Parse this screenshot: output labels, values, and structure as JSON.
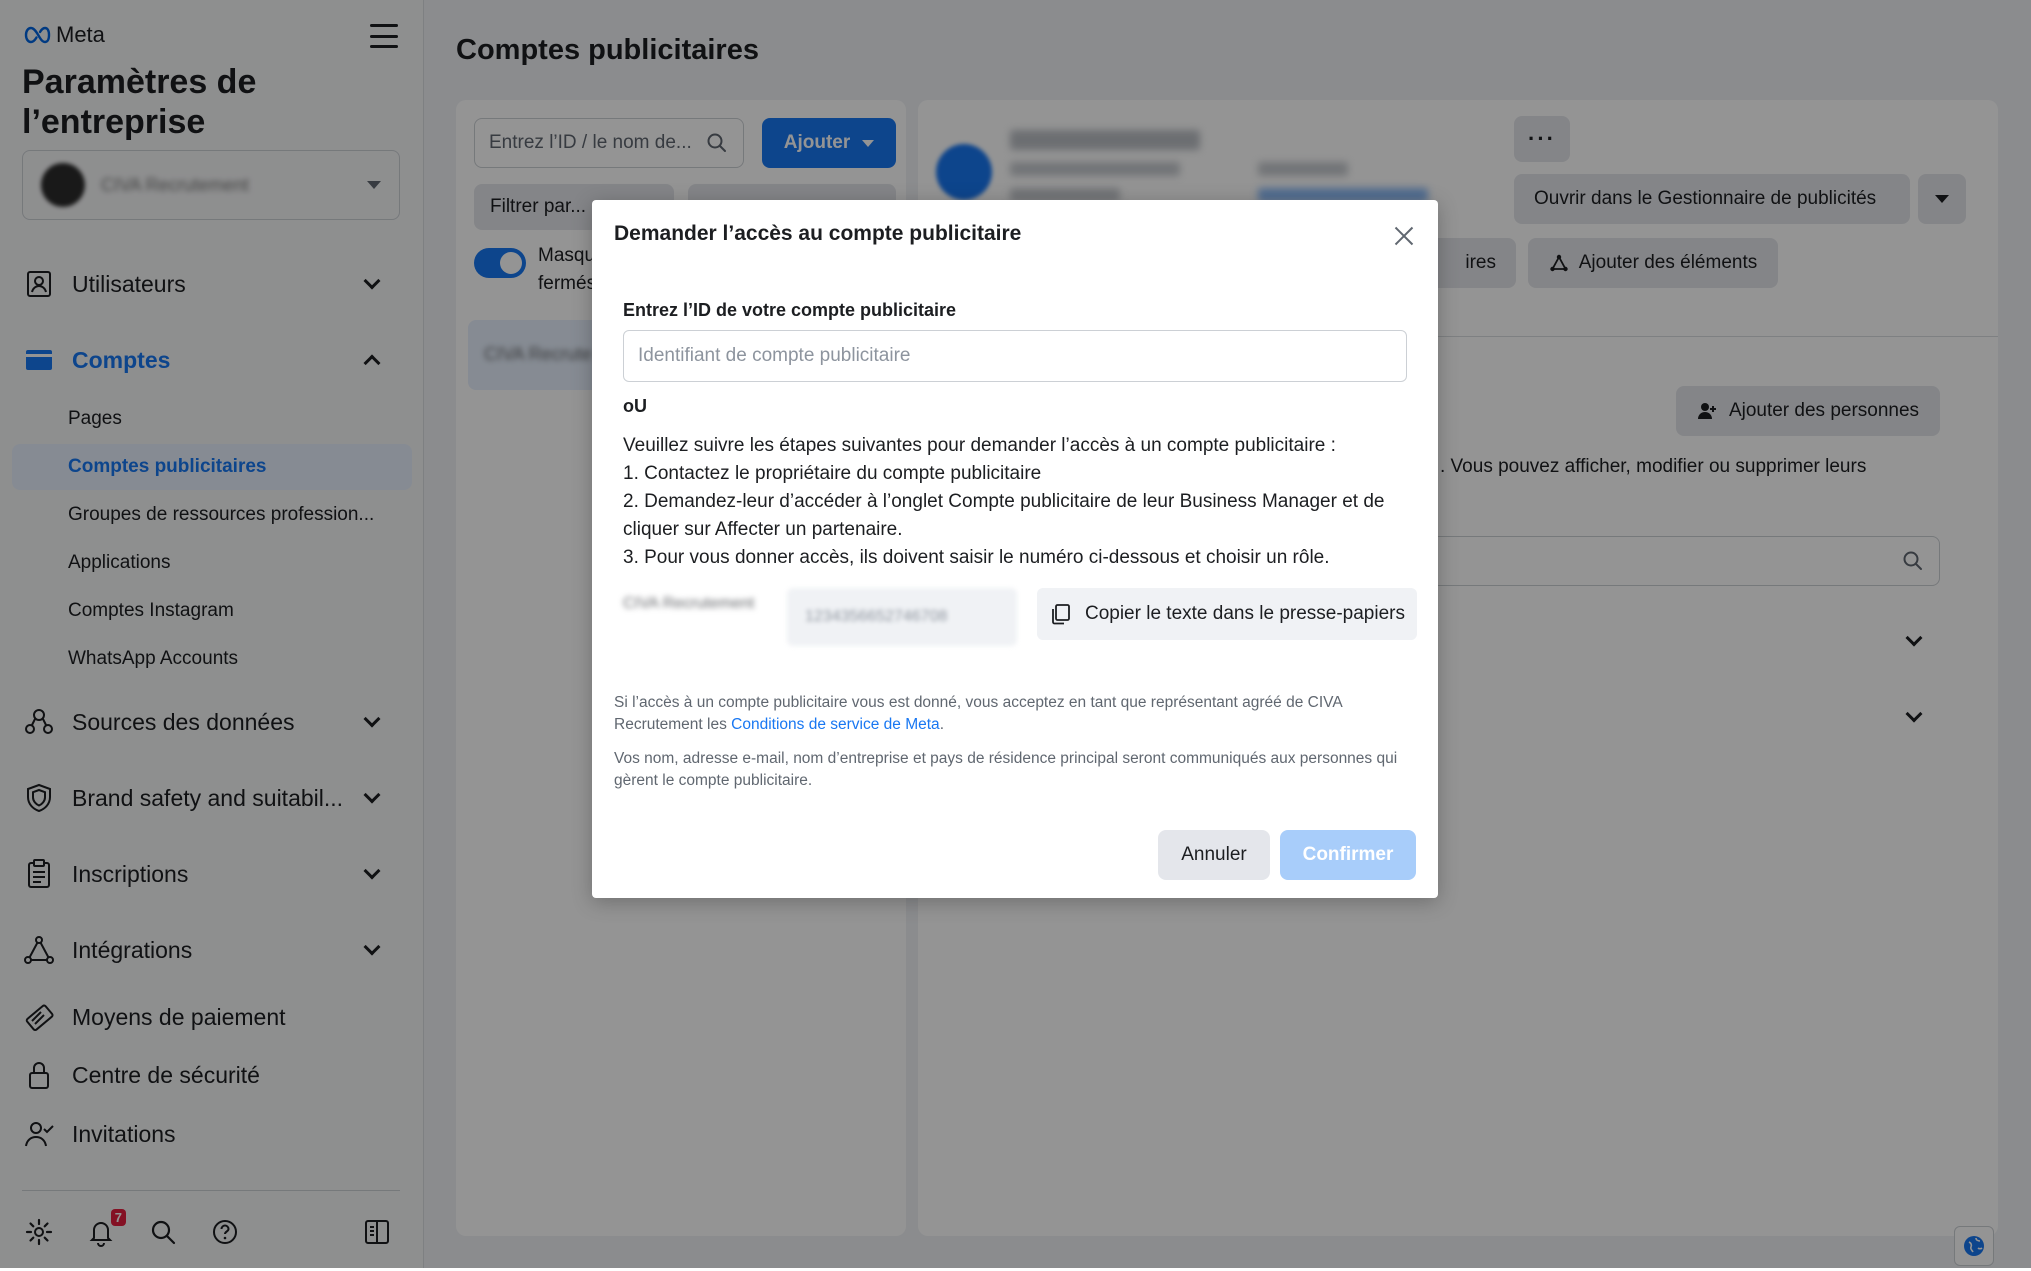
{
  "sidebar": {
    "brand": "Meta",
    "title": "Paramètres de l’entreprise",
    "business_name": "CIVA Recrutement",
    "nav": [
      {
        "label": "Utilisateurs",
        "icon": "users-icon"
      },
      {
        "label": "Comptes",
        "icon": "accounts-icon"
      },
      {
        "label": "Sources des données",
        "icon": "data-sources-icon"
      },
      {
        "label": "Brand safety and suitabil...",
        "icon": "shield-icon"
      },
      {
        "label": "Inscriptions",
        "icon": "clipboard-icon"
      },
      {
        "label": "Intégrations",
        "icon": "integrations-icon"
      },
      {
        "label": "Moyens de paiement",
        "icon": "payment-icon"
      },
      {
        "label": "Centre de sécurité",
        "icon": "lock-icon"
      },
      {
        "label": "Invitations",
        "icon": "invitations-icon"
      }
    ],
    "sub_items": [
      {
        "label": "Pages"
      },
      {
        "label": "Comptes publicitaires"
      },
      {
        "label": "Groupes de ressources profession..."
      },
      {
        "label": "Applications"
      },
      {
        "label": "Comptes Instagram"
      },
      {
        "label": "WhatsApp Accounts"
      }
    ],
    "footer": {
      "notification_count": "7",
      "icons": [
        "settings-icon",
        "bell-icon",
        "search-icon",
        "help-icon",
        "panel-toggle-icon"
      ]
    }
  },
  "main": {
    "page_title": "Comptes publicitaires",
    "search_placeholder": "Entrez l’ID / le nom de...",
    "add_button": "Ajouter",
    "filter_button": "Filtrer par...",
    "toggle_label": "Masqu fermés",
    "list_item": "CIVA Recrute",
    "account_name": "CIVA Recrutement",
    "open_button": "Ouvrir dans le Gestionnaire de publicités",
    "partners_button": "ires",
    "add_assets_button": "Ajouter des éléments",
    "add_people_button": "Ajouter des personnes",
    "people_desc": ". Vous pouvez afficher, modifier ou supprimer leurs"
  },
  "modal": {
    "title": "Demander l’accès au compte publicitaire",
    "id_label": "Entrez l’ID de votre compte publicitaire",
    "id_placeholder": "Identifiant de compte publicitaire",
    "or_text": "oU",
    "steps_intro": "Veuillez suivre les étapes suivantes pour demander l’accès à un compte publicitaire :",
    "step1": "1. Contactez le propriétaire du compte publicitaire",
    "step2": "2. Demandez-leur d’accéder à l’onglet Compte publicitaire de leur Business Manager et de cliquer sur Affecter un partenaire.",
    "step3": "3. Pour vous donner accès, ils doivent saisir le numéro ci-dessous et choisir un rôle.",
    "copy_name": "CIVA Recrutement",
    "copy_id": "1234356652746708",
    "copy_button": "Copier le texte dans le presse-papiers",
    "legal1_text": "Si l’accès à un compte publicitaire vous est donné, vous acceptez en tant que représentant agréé de CIVA Recrutement les ",
    "legal1_link": "Conditions de service de Meta",
    "legal1_end": ".",
    "legal2": "Vos nom, adresse e-mail, nom d’entreprise et pays de résidence principal seront communiqués aux personnes qui gèrent le compte publicitaire.",
    "cancel": "Annuler",
    "confirm": "Confirmer"
  },
  "colors": {
    "accent": "#1877f2",
    "active_bg": "#e7f0fd",
    "confirm_disabled": "#a8cdfa"
  }
}
